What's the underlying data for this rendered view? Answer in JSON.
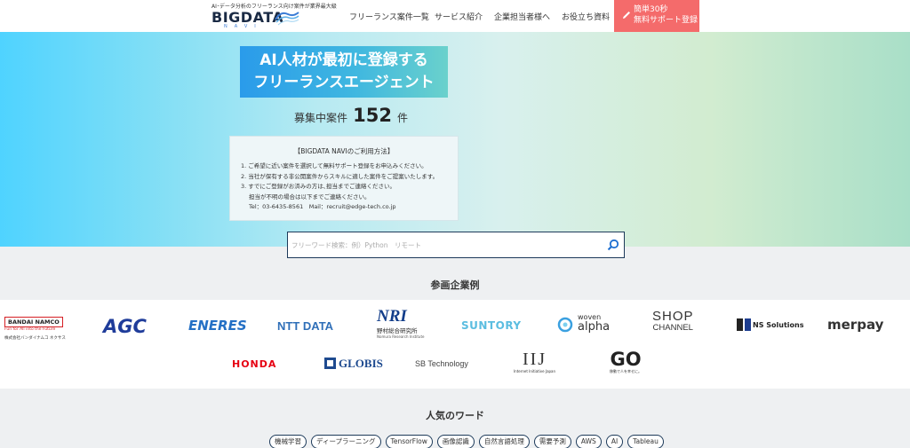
{
  "header": {
    "logo_tagline": "AI･データ分析のフリーランス向け案件が業界最大級",
    "logo_main": "BIGDATA",
    "logo_sub": "NAVI",
    "nav": [
      {
        "label": "フリーランス案件一覧"
      },
      {
        "label": "サービス紹介"
      },
      {
        "label": "企業担当者様へ"
      },
      {
        "label": "お役立ち資料"
      }
    ],
    "cta_line1": "簡単30秒",
    "cta_line2": "無料サポート登録",
    "cta_color": "#f46b6b"
  },
  "hero": {
    "title_line1": "AI人材が最初に登録する",
    "title_line2": "フリーランスエージェント",
    "count_label": "募集中案件",
    "count_value": "152",
    "count_unit": "件",
    "info_title": "【BIGDATA NAVIのご利用方法】",
    "info_lines": [
      "1. ご希望に近い案件を選択して無料サポート登録をお申込みください。",
      "2. 当社が保有する非公開案件からスキルに適した案件をご提案いたします。",
      "3. すでにご登録がお済みの方は､担当までご連絡ください。",
      "担当が不明の場合は以下までご連絡ください。",
      "Tel：03-6435-8561　Mail：recruit@edge-tech.co.jp"
    ],
    "search_placeholder": "フリーワード検索：例）Python　リモート"
  },
  "companies": {
    "title": "参画企業例",
    "bandai_namco": "BANDAI NAMCO",
    "bandai_sub1": "Fun for All into the Future",
    "bandai_sub2": "株式会社バンダイナムコ ネクサス",
    "agc": "AGC",
    "eneres": "ENERES",
    "nttdata": "NTT DATA",
    "nri": "NRI",
    "nri_sub1": "野村総合研究所",
    "nri_sub2": "Nomura Research Institute",
    "suntory": "SUNTORY",
    "woven_1": "woven",
    "woven_2": "alpha",
    "shop_1": "SHOP",
    "shop_2": "CHANNEL",
    "ns_solutions": "NS Solutions",
    "merpay": "merpay",
    "honda": "HONDA",
    "globis": "GLOBIS",
    "sbtech": "SB Technology",
    "iij": "IIJ",
    "iij_sub": "Internet Initiative Japan",
    "go": "GO",
    "go_sub": "移動で人を幸せに。"
  },
  "popular": {
    "title": "人気のワード",
    "tags": [
      "機械学習",
      "ディープラーニング",
      "TensorFlow",
      "画像認識",
      "自然言語処理",
      "需要予測",
      "AWS",
      "AI",
      "Tableau"
    ]
  }
}
